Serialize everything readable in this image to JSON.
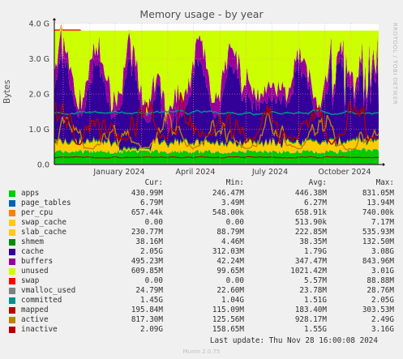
{
  "chart_data": {
    "type": "area",
    "title": "Memory usage - by year",
    "ylabel": "Bytes",
    "y_ticks": [
      "0.0",
      "1.0 G",
      "2.0 G",
      "3.0 G",
      "4.0 G"
    ],
    "ylim": [
      0,
      4.0
    ],
    "x_ticks": [
      "January 2024",
      "April 2024",
      "July 2024",
      "October 2024"
    ],
    "vendor_text": "RRDTOOL / TOBI OETIKER",
    "grid": true,
    "stack_order": [
      "apps",
      "page_tables",
      "per_cpu",
      "swap_cache",
      "slab_cache",
      "shmem",
      "cache",
      "buffers",
      "unused",
      "swap"
    ],
    "columns": [
      "Cur:",
      "Min:",
      "Avg:",
      "Max:"
    ],
    "series": [
      {
        "name": "apps",
        "color": "#00cc00",
        "cur": "430.99M",
        "min": "246.47M",
        "avg": "446.38M",
        "max": "831.05M"
      },
      {
        "name": "page_tables",
        "color": "#0066b3",
        "cur": "6.79M",
        "min": "3.49M",
        "avg": "6.27M",
        "max": "13.94M"
      },
      {
        "name": "per_cpu",
        "color": "#ff8000",
        "cur": "657.44k",
        "min": "548.00k",
        "avg": "658.91k",
        "max": "740.00k"
      },
      {
        "name": "swap_cache",
        "color": "#ffcc00",
        "cur": "0.00",
        "min": "0.00",
        "avg": "513.90k",
        "max": "7.17M"
      },
      {
        "name": "slab_cache",
        "color": "#ffcc00",
        "cur": "230.77M",
        "min": "88.79M",
        "avg": "222.85M",
        "max": "535.93M"
      },
      {
        "name": "shmem",
        "color": "#008f00",
        "cur": "38.16M",
        "min": "4.46M",
        "avg": "38.35M",
        "max": "132.50M"
      },
      {
        "name": "cache",
        "color": "#330099",
        "cur": "2.05G",
        "min": "312.03M",
        "avg": "1.79G",
        "max": "3.08G"
      },
      {
        "name": "buffers",
        "color": "#990099",
        "cur": "495.23M",
        "min": "42.24M",
        "avg": "347.47M",
        "max": "843.96M"
      },
      {
        "name": "unused",
        "color": "#ccff00",
        "cur": "609.85M",
        "min": "99.65M",
        "avg": "1021.42M",
        "max": "3.01G"
      },
      {
        "name": "swap",
        "color": "#ff0000",
        "cur": "0.00",
        "min": "0.00",
        "avg": "5.57M",
        "max": "88.88M"
      },
      {
        "name": "vmalloc_used",
        "color": "#808080",
        "cur": "24.79M",
        "min": "22.60M",
        "avg": "23.78M",
        "max": "28.76M"
      },
      {
        "name": "committed",
        "color": "#008f8f",
        "cur": "1.45G",
        "min": "1.04G",
        "avg": "1.51G",
        "max": "2.05G"
      },
      {
        "name": "mapped",
        "color": "#c00000",
        "cur": "195.84M",
        "min": "115.09M",
        "avg": "183.40M",
        "max": "303.53M"
      },
      {
        "name": "active",
        "color": "#c08000",
        "cur": "817.30M",
        "min": "125.56M",
        "avg": "928.17M",
        "max": "2.49G"
      },
      {
        "name": "inactive",
        "color": "#b00000",
        "cur": "2.09G",
        "min": "158.65M",
        "avg": "1.55G",
        "max": "3.16G"
      }
    ]
  },
  "footer": {
    "last_update": "Last update: Thu Nov 28 16:00:08 2024",
    "munin": "Munin 2.0.75"
  }
}
